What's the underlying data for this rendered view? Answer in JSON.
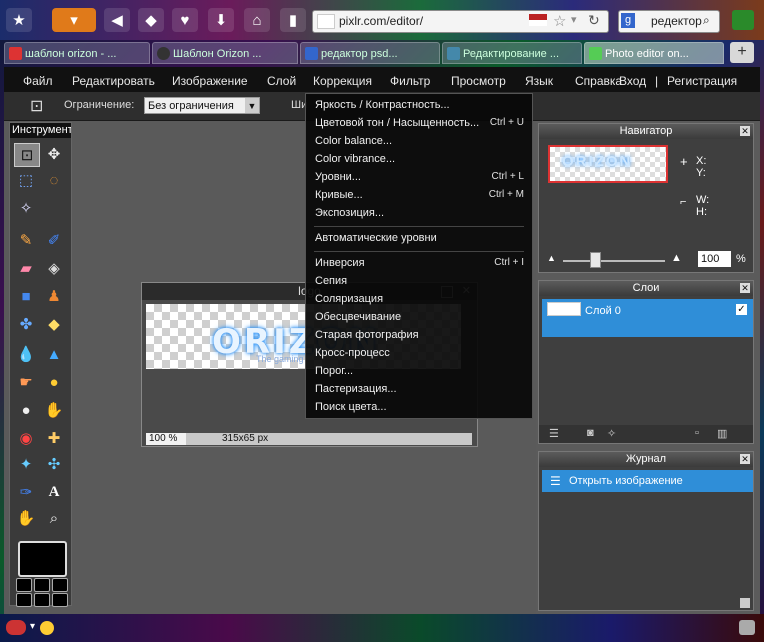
{
  "browser": {
    "url": "pixlr.com/editor/",
    "search_text": "редектор",
    "tabs": [
      {
        "label": "шаблон orizon - ..."
      },
      {
        "label": "Шаблон Orizon ..."
      },
      {
        "label": "редактор psd..."
      },
      {
        "label": "Редактирование ..."
      },
      {
        "label": "Photo editor on..."
      }
    ],
    "new_tab": "+"
  },
  "menubar": {
    "items": [
      "Файл",
      "Редактировать",
      "Изображение",
      "Слой",
      "Коррекция",
      "Фильтр",
      "Просмотр",
      "Язык",
      "Справка"
    ],
    "login": "Вход",
    "sep": "|",
    "register": "Регистрация"
  },
  "options": {
    "constraint_label": "Ограничение:",
    "constraint_value": "Без ограничения",
    "width_label": "Ши"
  },
  "toolbox": {
    "title": "Инструменты"
  },
  "image_window": {
    "title": "logo",
    "logo_text": "ORIZON",
    "tagline": "The gaming",
    "zoom": "100 %",
    "size": "315x65 px"
  },
  "dropdown": {
    "items": [
      {
        "label": "Яркость / Контрастность...",
        "shortcut": ""
      },
      {
        "label": "Цветовой тон / Насыщенность...",
        "shortcut": "Ctrl + U"
      },
      {
        "label": "Color balance...",
        "shortcut": ""
      },
      {
        "label": "Color vibrance...",
        "shortcut": ""
      },
      {
        "label": "Уровни...",
        "shortcut": "Ctrl + L"
      },
      {
        "label": "Кривые...",
        "shortcut": "Ctrl + M"
      },
      {
        "label": "Экспозиция...",
        "shortcut": ""
      },
      {
        "label": "Автоматические уровни",
        "shortcut": ""
      },
      {
        "label": "Инверсия",
        "shortcut": "Ctrl + I"
      },
      {
        "label": "Сепия",
        "shortcut": ""
      },
      {
        "label": "Соляризация",
        "shortcut": ""
      },
      {
        "label": "Обесцвечивание",
        "shortcut": ""
      },
      {
        "label": "Старая фотография",
        "shortcut": ""
      },
      {
        "label": "Кросс-процесс",
        "shortcut": ""
      },
      {
        "label": "Порог...",
        "shortcut": ""
      },
      {
        "label": "Пастеризация...",
        "shortcut": ""
      },
      {
        "label": "Поиск цвета...",
        "shortcut": ""
      }
    ]
  },
  "navigator": {
    "title": "Навигатор",
    "x_label": "X:",
    "y_label": "Y:",
    "w_label": "W:",
    "h_label": "H:",
    "zoom_value": "100",
    "zoom_unit": "%",
    "zoom_level": 0.3,
    "thumb_text": "ORIZON"
  },
  "layers": {
    "title": "Слои",
    "items": [
      {
        "name": "Слой 0"
      }
    ]
  },
  "journal": {
    "title": "Журнал",
    "items": [
      {
        "label": "Открыть изображение"
      }
    ]
  },
  "colors": {
    "accent": "#2f8ed8",
    "menubar": "#111111",
    "workspace": "#5a5a5a"
  }
}
